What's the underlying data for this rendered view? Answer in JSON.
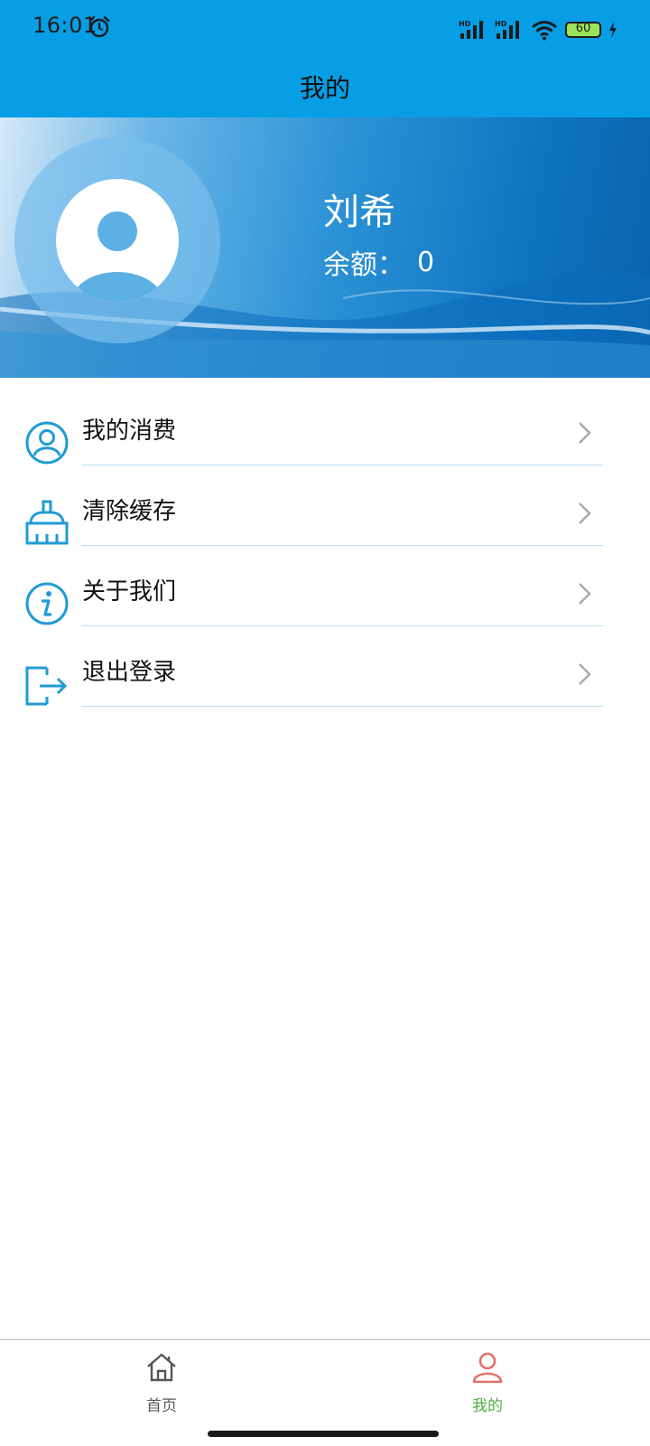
{
  "status_bar": {
    "time": "16:01",
    "battery": "60",
    "icons": [
      "alarm-icon",
      "hd-signal-icon",
      "hd-signal-icon",
      "wifi-icon",
      "battery-icon",
      "charging-icon"
    ]
  },
  "header": {
    "title": "我的"
  },
  "profile": {
    "name": "刘希",
    "balance_label": "余额：",
    "balance_value": "0"
  },
  "menu": {
    "items": [
      {
        "label": "我的消费",
        "icon": "user-circle-icon"
      },
      {
        "label": "清除缓存",
        "icon": "broom-icon"
      },
      {
        "label": "关于我们",
        "icon": "info-icon"
      },
      {
        "label": "退出登录",
        "icon": "logout-icon"
      }
    ]
  },
  "bottom_nav": {
    "items": [
      {
        "label": "首页",
        "icon": "home-icon",
        "active": false
      },
      {
        "label": "我的",
        "icon": "user-icon",
        "active": true
      }
    ]
  },
  "colors": {
    "primary": "#079ee5",
    "menu_icon": "#1f9bd6",
    "active_tab_label": "#4caf3d",
    "active_tab_icon": "#e0726a"
  }
}
